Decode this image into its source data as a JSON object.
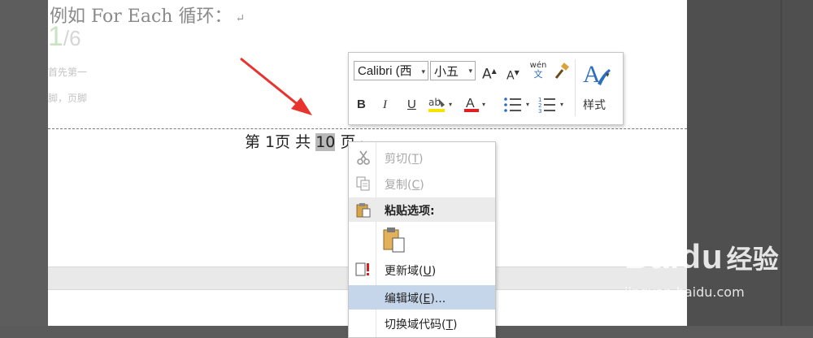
{
  "document": {
    "top_line": "例如 For Each 循环：",
    "paragraph_mark": "↵",
    "step_number": "1",
    "step_total": "/6",
    "bg_line1": "首先第一",
    "bg_line2": "脚，页脚",
    "footer": {
      "prefix": "第 1页 共 ",
      "highlight": "10",
      "suffix": " 页"
    }
  },
  "mini_toolbar": {
    "font_name": "Calibri (西",
    "font_size": "小五",
    "grow_font": "A",
    "shrink_font": "A",
    "phonetic_top": "wén",
    "phonetic_bottom": "文",
    "bold": "B",
    "italic": "I",
    "underline": "U",
    "font_color": "A",
    "styles_label": "样式"
  },
  "context_menu": {
    "cut": {
      "label": "剪切",
      "key": "T"
    },
    "copy": {
      "label": "复制",
      "key": "C"
    },
    "paste_options": "粘贴选项:",
    "update_field": {
      "label": "更新域",
      "key": "U"
    },
    "edit_field": {
      "label": "编辑域",
      "key": "E",
      "suffix": "..."
    },
    "toggle_field": {
      "label": "切换域代码",
      "key": "T"
    }
  },
  "watermark": {
    "brand": "Baidu",
    "brand_cn": "经验",
    "url": "jingyan.baidu.com"
  },
  "colors": {
    "arrow": "#e8332e",
    "highlight_color": "#f5e400",
    "font_color": "#e02020",
    "menu_hover": "#c5d5ea"
  }
}
